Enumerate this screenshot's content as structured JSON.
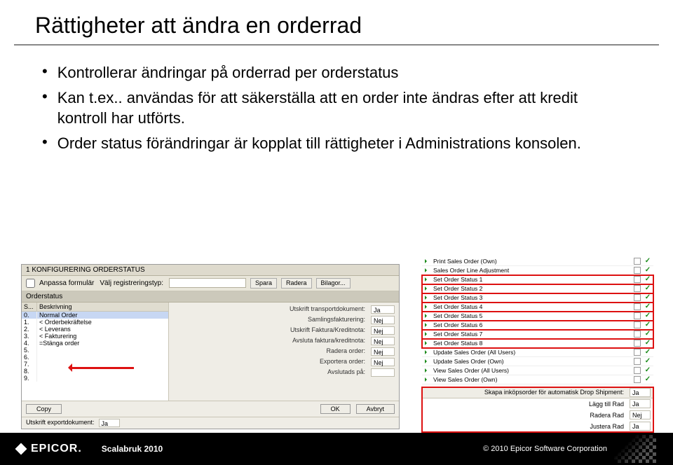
{
  "title": "Rättigheter att ändra en orderrad",
  "bullets": [
    "Kontrollerar ändringar på orderrad per orderstatus",
    "Kan t.ex.. användas för att säkerställa att en order inte ändras efter att kredit kontroll har utförts.",
    "Order status förändringar är kopplat till rättigheter i Administrations konsolen."
  ],
  "dialog": {
    "window_title": "1 KONFIGURERING ORDERSTATUS",
    "toolbar": {
      "anpassa": "Anpassa formulär",
      "valj_label": "Välj registreringstyp:",
      "spara": "Spara",
      "radera": "Radera",
      "bilagor": "Bilagor..."
    },
    "sub": "Orderstatus",
    "list_head": {
      "c1": "S...",
      "c2": "Beskrivning"
    },
    "rows": [
      {
        "n": "0.",
        "t": "Normal Order",
        "hl": true
      },
      {
        "n": "1.",
        "t": "< Orderbekräftelse"
      },
      {
        "n": "2.",
        "t": "< Leverans"
      },
      {
        "n": "3.",
        "t": "< Fakturering"
      },
      {
        "n": "4.",
        "t": "=Stänga order"
      },
      {
        "n": "5.",
        "t": ""
      },
      {
        "n": "6.",
        "t": ""
      },
      {
        "n": "7.",
        "t": ""
      },
      {
        "n": "8.",
        "t": ""
      },
      {
        "n": "9.",
        "t": ""
      }
    ],
    "kv": [
      {
        "k": "Utskrift transportdokument:",
        "v": "Ja"
      },
      {
        "k": "Samlingsfakturering:",
        "v": "Nej"
      },
      {
        "k": "Utskrift Faktura/Kreditnota:",
        "v": "Nej"
      },
      {
        "k": "Avsluta faktura/kreditnota:",
        "v": "Nej"
      },
      {
        "k": "Radera order:",
        "v": "Nej"
      },
      {
        "k": "Exportera order:",
        "v": "Nej"
      },
      {
        "k": "Avslutads på:",
        "v": ""
      }
    ],
    "buttons": {
      "copy": "Copy",
      "ok": "OK",
      "avbryt": "Avbryt"
    },
    "foot": {
      "label": "Utskrift exportdokument:",
      "v": "Ja"
    }
  },
  "perm_list": [
    {
      "t": "Print Sales Order (Own)"
    },
    {
      "t": "Sales Order Line Adjustment"
    },
    {
      "t": "Set Order Status 1",
      "red": true
    },
    {
      "t": "Set Order Status 2",
      "red": true
    },
    {
      "t": "Set Order Status 3",
      "red": true
    },
    {
      "t": "Set Order Status 4",
      "red": true
    },
    {
      "t": "Set Order Status 5",
      "red": true
    },
    {
      "t": "Set Order Status 6",
      "red": true
    },
    {
      "t": "Set Order Status 7",
      "red": true
    },
    {
      "t": "Set Order Status 8",
      "red": true
    },
    {
      "t": "Update Sales Order (All Users)"
    },
    {
      "t": "Update Sales Order (Own)"
    },
    {
      "t": "View Sales Order (All Users)"
    },
    {
      "t": "View Sales Order (Own)"
    }
  ],
  "perm_block2": {
    "header": "Skapa inköpsorder för automatisk Drop Shipment:",
    "header_v": "Ja",
    "rows": [
      {
        "k": "Lägg till Rad",
        "v": "Ja"
      },
      {
        "k": "Radera Rad",
        "v": "Nej"
      },
      {
        "k": "Justera Rad",
        "v": "Ja"
      }
    ]
  },
  "footer": {
    "logo": "EPICOR.",
    "event": "Scalabruk 2010",
    "copy": "© 2010 Epicor Software Corporation"
  }
}
